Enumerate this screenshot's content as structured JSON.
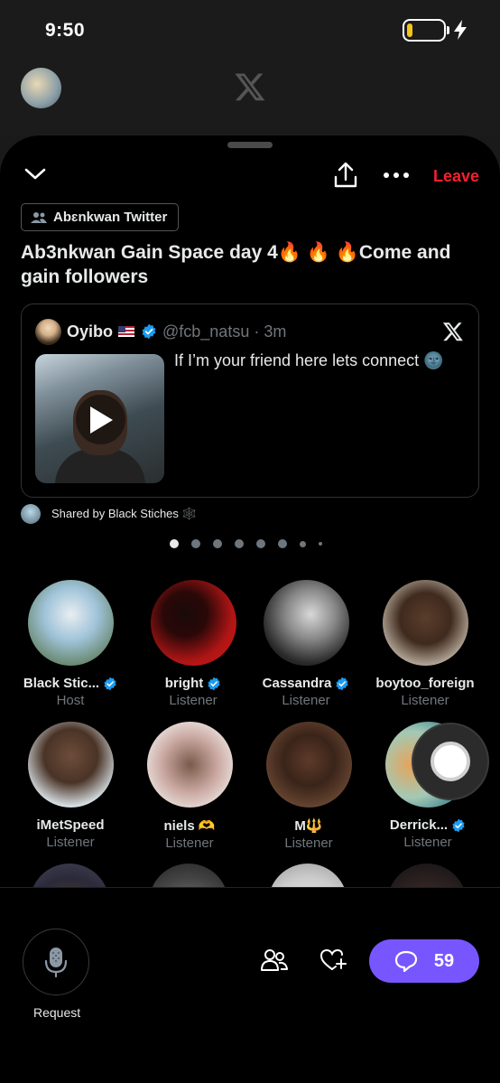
{
  "status": {
    "time": "9:50"
  },
  "header": {
    "community": "Abɛnkwan Twitter",
    "leave_label": "Leave"
  },
  "space": {
    "title": "Ab3nkwan Gain Space day 4🔥 🔥 🔥Come and gain followers"
  },
  "tweet": {
    "name": "Oyibo",
    "handle": "@fcb_natsu · 3m",
    "text": "If I’m your friend here lets connect 🌚"
  },
  "shared_by": "Shared by Black Stiches 🕸️",
  "participants": [
    {
      "name": "Black Stic...",
      "role": "Host",
      "verified": true
    },
    {
      "name": "bright",
      "role": "Listener",
      "verified": true
    },
    {
      "name": "Cassandra",
      "role": "Listener",
      "verified": true
    },
    {
      "name": "boytoo_foreign",
      "role": "Listener",
      "verified": false
    },
    {
      "name": "iMetSpeed",
      "role": "Listener",
      "verified": false
    },
    {
      "name": "niels 🫶",
      "role": "Listener",
      "verified": false
    },
    {
      "name": "M🔱",
      "role": "Listener",
      "verified": false
    },
    {
      "name": "Derrick...",
      "role": "Listener",
      "verified": true
    }
  ],
  "bottom": {
    "request_label": "Request",
    "comment_count": "59"
  },
  "icons": {
    "chevron": "chevron-down-icon",
    "share": "share-icon",
    "more": "more-icon",
    "x_logo": "x-logo-icon",
    "mic": "microphone-icon",
    "people": "people-icon",
    "heart": "heart-plus-icon",
    "comment": "comment-icon"
  },
  "colors": {
    "leave": "#f4212e",
    "verified": "#1d9bf0",
    "accent": "#7856ff",
    "battery": "#f5c518"
  }
}
